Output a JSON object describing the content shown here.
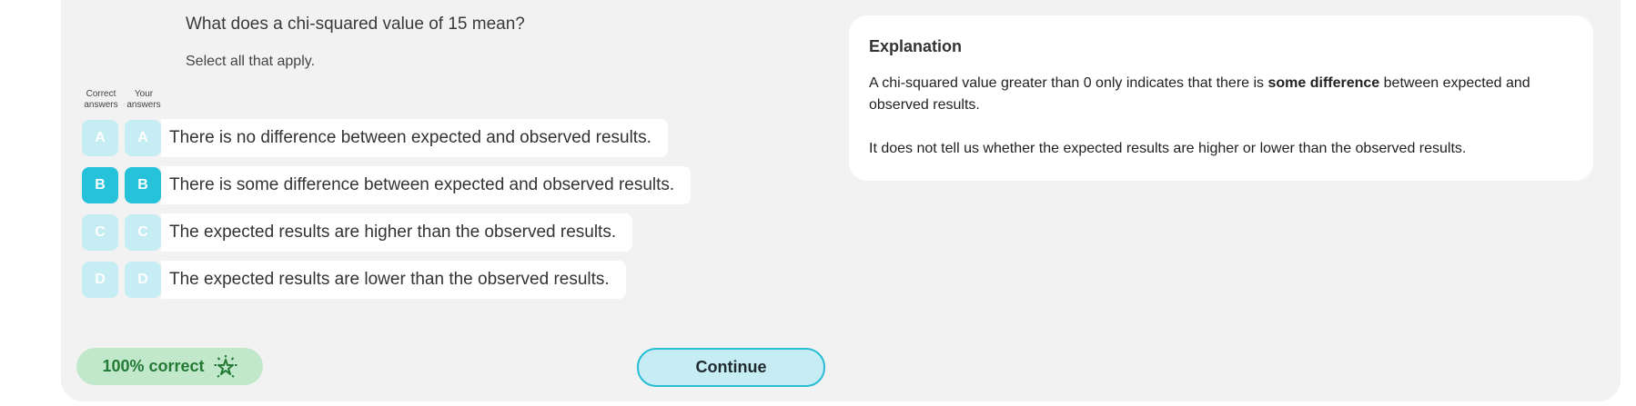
{
  "question": {
    "text": "What does a chi-squared value of 15 mean?",
    "instruction": "Select all that apply."
  },
  "columns": {
    "correct_line1": "Correct",
    "correct_line2": "answers",
    "yours_line1": "Your",
    "yours_line2": "answers"
  },
  "options": [
    {
      "letter": "A",
      "text": "There is no difference between expected and observed results.",
      "selected": false
    },
    {
      "letter": "B",
      "text": "There is some difference between expected and observed results.",
      "selected": true
    },
    {
      "letter": "C",
      "text": "The expected results are higher than the observed results.",
      "selected": false
    },
    {
      "letter": "D",
      "text": "The expected results are lower than the observed results.",
      "selected": false
    }
  ],
  "explanation": {
    "title": "Explanation",
    "p1_before": "A chi-squared value greater than 0 only indicates that there is ",
    "p1_bold": "some difference",
    "p1_after": " between expected and observed results.",
    "p2": "It does not tell us whether the expected results are higher or lower than the observed results."
  },
  "score": {
    "label": "100% correct",
    "icon": "sparkle-star-icon"
  },
  "continue_label": "Continue",
  "colors": {
    "accent": "#26c2d9",
    "accent_pale": "#c6edf3",
    "success_bg": "#c2e8cb",
    "success_text": "#237a35",
    "panel_bg": "#f2f2f2"
  }
}
